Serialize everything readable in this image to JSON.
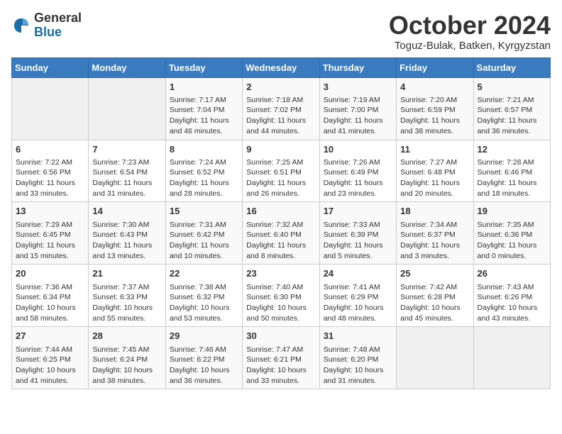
{
  "header": {
    "logo_general": "General",
    "logo_blue": "Blue",
    "month_title": "October 2024",
    "location": "Toguz-Bulak, Batken, Kyrgyzstan"
  },
  "days_of_week": [
    "Sunday",
    "Monday",
    "Tuesday",
    "Wednesday",
    "Thursday",
    "Friday",
    "Saturday"
  ],
  "weeks": [
    [
      {
        "day": "",
        "content": ""
      },
      {
        "day": "",
        "content": ""
      },
      {
        "day": "1",
        "content": "Sunrise: 7:17 AM\nSunset: 7:04 PM\nDaylight: 11 hours and 46 minutes."
      },
      {
        "day": "2",
        "content": "Sunrise: 7:18 AM\nSunset: 7:02 PM\nDaylight: 11 hours and 44 minutes."
      },
      {
        "day": "3",
        "content": "Sunrise: 7:19 AM\nSunset: 7:00 PM\nDaylight: 11 hours and 41 minutes."
      },
      {
        "day": "4",
        "content": "Sunrise: 7:20 AM\nSunset: 6:59 PM\nDaylight: 11 hours and 38 minutes."
      },
      {
        "day": "5",
        "content": "Sunrise: 7:21 AM\nSunset: 6:57 PM\nDaylight: 11 hours and 36 minutes."
      }
    ],
    [
      {
        "day": "6",
        "content": "Sunrise: 7:22 AM\nSunset: 6:56 PM\nDaylight: 11 hours and 33 minutes."
      },
      {
        "day": "7",
        "content": "Sunrise: 7:23 AM\nSunset: 6:54 PM\nDaylight: 11 hours and 31 minutes."
      },
      {
        "day": "8",
        "content": "Sunrise: 7:24 AM\nSunset: 6:52 PM\nDaylight: 11 hours and 28 minutes."
      },
      {
        "day": "9",
        "content": "Sunrise: 7:25 AM\nSunset: 6:51 PM\nDaylight: 11 hours and 26 minutes."
      },
      {
        "day": "10",
        "content": "Sunrise: 7:26 AM\nSunset: 6:49 PM\nDaylight: 11 hours and 23 minutes."
      },
      {
        "day": "11",
        "content": "Sunrise: 7:27 AM\nSunset: 6:48 PM\nDaylight: 11 hours and 20 minutes."
      },
      {
        "day": "12",
        "content": "Sunrise: 7:28 AM\nSunset: 6:46 PM\nDaylight: 11 hours and 18 minutes."
      }
    ],
    [
      {
        "day": "13",
        "content": "Sunrise: 7:29 AM\nSunset: 6:45 PM\nDaylight: 11 hours and 15 minutes."
      },
      {
        "day": "14",
        "content": "Sunrise: 7:30 AM\nSunset: 6:43 PM\nDaylight: 11 hours and 13 minutes."
      },
      {
        "day": "15",
        "content": "Sunrise: 7:31 AM\nSunset: 6:42 PM\nDaylight: 11 hours and 10 minutes."
      },
      {
        "day": "16",
        "content": "Sunrise: 7:32 AM\nSunset: 6:40 PM\nDaylight: 11 hours and 8 minutes."
      },
      {
        "day": "17",
        "content": "Sunrise: 7:33 AM\nSunset: 6:39 PM\nDaylight: 11 hours and 5 minutes."
      },
      {
        "day": "18",
        "content": "Sunrise: 7:34 AM\nSunset: 6:37 PM\nDaylight: 11 hours and 3 minutes."
      },
      {
        "day": "19",
        "content": "Sunrise: 7:35 AM\nSunset: 6:36 PM\nDaylight: 11 hours and 0 minutes."
      }
    ],
    [
      {
        "day": "20",
        "content": "Sunrise: 7:36 AM\nSunset: 6:34 PM\nDaylight: 10 hours and 58 minutes."
      },
      {
        "day": "21",
        "content": "Sunrise: 7:37 AM\nSunset: 6:33 PM\nDaylight: 10 hours and 55 minutes."
      },
      {
        "day": "22",
        "content": "Sunrise: 7:38 AM\nSunset: 6:32 PM\nDaylight: 10 hours and 53 minutes."
      },
      {
        "day": "23",
        "content": "Sunrise: 7:40 AM\nSunset: 6:30 PM\nDaylight: 10 hours and 50 minutes."
      },
      {
        "day": "24",
        "content": "Sunrise: 7:41 AM\nSunset: 6:29 PM\nDaylight: 10 hours and 48 minutes."
      },
      {
        "day": "25",
        "content": "Sunrise: 7:42 AM\nSunset: 6:28 PM\nDaylight: 10 hours and 45 minutes."
      },
      {
        "day": "26",
        "content": "Sunrise: 7:43 AM\nSunset: 6:26 PM\nDaylight: 10 hours and 43 minutes."
      }
    ],
    [
      {
        "day": "27",
        "content": "Sunrise: 7:44 AM\nSunset: 6:25 PM\nDaylight: 10 hours and 41 minutes."
      },
      {
        "day": "28",
        "content": "Sunrise: 7:45 AM\nSunset: 6:24 PM\nDaylight: 10 hours and 38 minutes."
      },
      {
        "day": "29",
        "content": "Sunrise: 7:46 AM\nSunset: 6:22 PM\nDaylight: 10 hours and 36 minutes."
      },
      {
        "day": "30",
        "content": "Sunrise: 7:47 AM\nSunset: 6:21 PM\nDaylight: 10 hours and 33 minutes."
      },
      {
        "day": "31",
        "content": "Sunrise: 7:48 AM\nSunset: 6:20 PM\nDaylight: 10 hours and 31 minutes."
      },
      {
        "day": "",
        "content": ""
      },
      {
        "day": "",
        "content": ""
      }
    ]
  ]
}
